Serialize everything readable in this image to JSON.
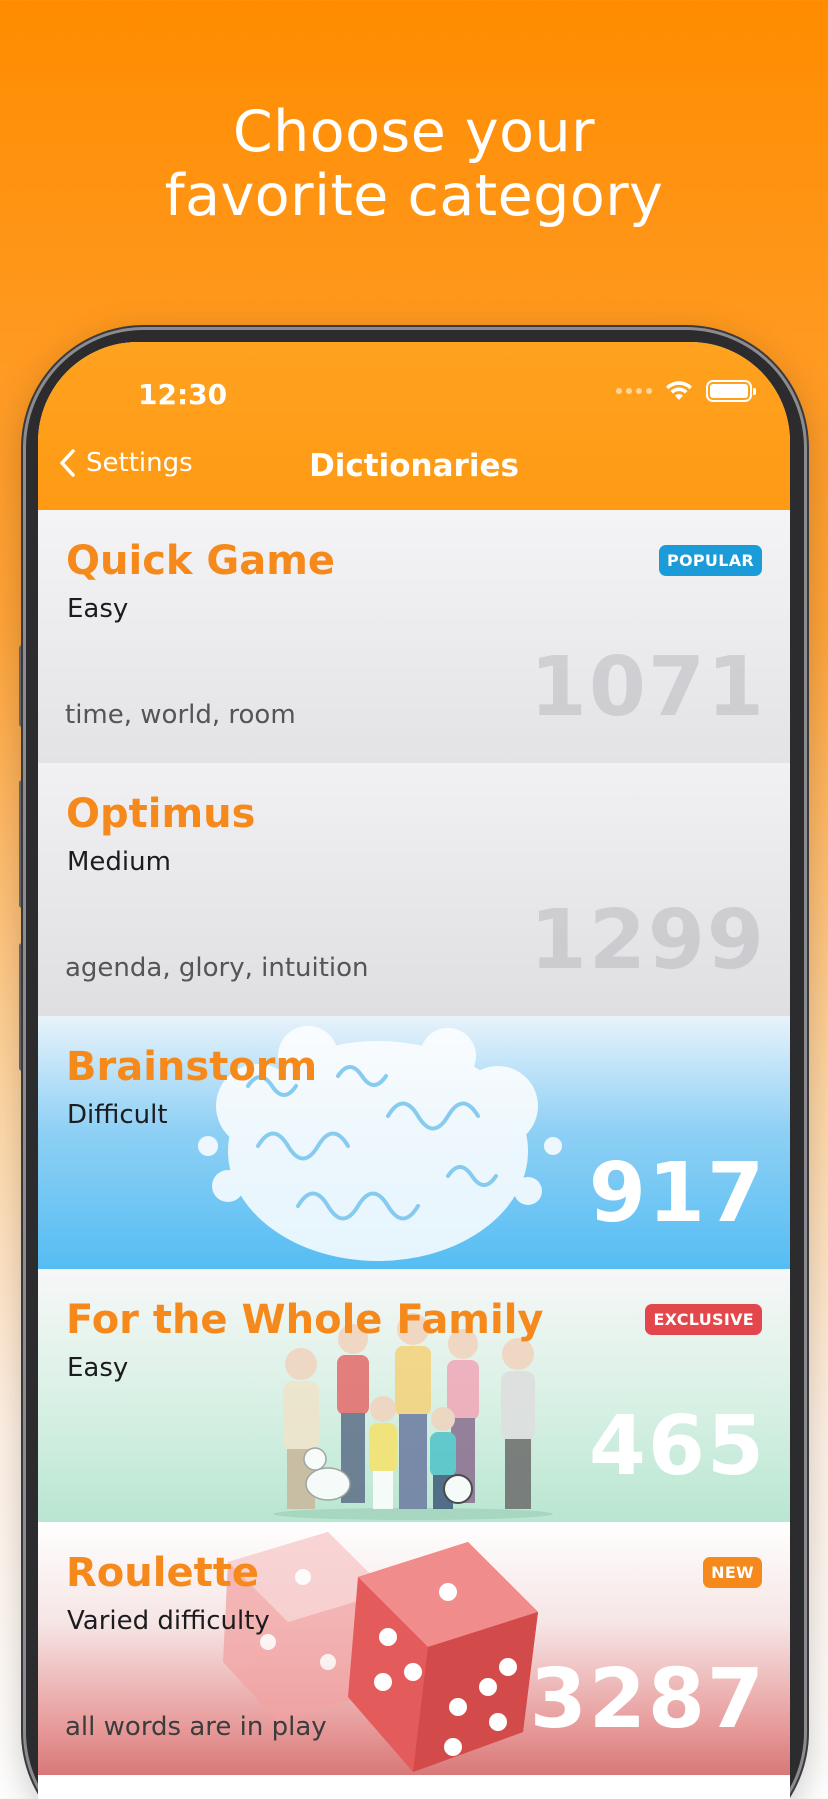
{
  "headline": {
    "line1": "Choose your",
    "line2": "favorite category"
  },
  "status_bar": {
    "time": "12:30"
  },
  "navbar": {
    "back_label": "Settings",
    "title": "Dictionaries"
  },
  "categories": [
    {
      "name": "Quick Game",
      "level": "Easy",
      "sample": "time, world, room",
      "count": "1071",
      "badge": "POPULAR"
    },
    {
      "name": "Optimus",
      "level": "Medium",
      "sample": "agenda, glory, intuition",
      "count": "1299"
    },
    {
      "name": "Brainstorm",
      "level": "Difficult",
      "count": "917"
    },
    {
      "name": "For the Whole Family",
      "level": "Easy",
      "count": "465",
      "badge": "EXCLUSIVE"
    },
    {
      "name": "Roulette",
      "level": "Varied difficulty",
      "sample": "all words are in play",
      "count": "3287",
      "badge": "NEW"
    }
  ],
  "colors": {
    "accent_orange": "#f5891b",
    "navbar_orange": "#ffa21f",
    "badge_popular": "#1b9bd7",
    "badge_exclusive": "#e3474b",
    "badge_new": "#f5891b"
  },
  "icons": [
    "chevron-left-icon",
    "wifi-icon",
    "battery-icon",
    "signal-dots-icon",
    "brain-illustration",
    "family-illustration",
    "dice-illustration"
  ]
}
